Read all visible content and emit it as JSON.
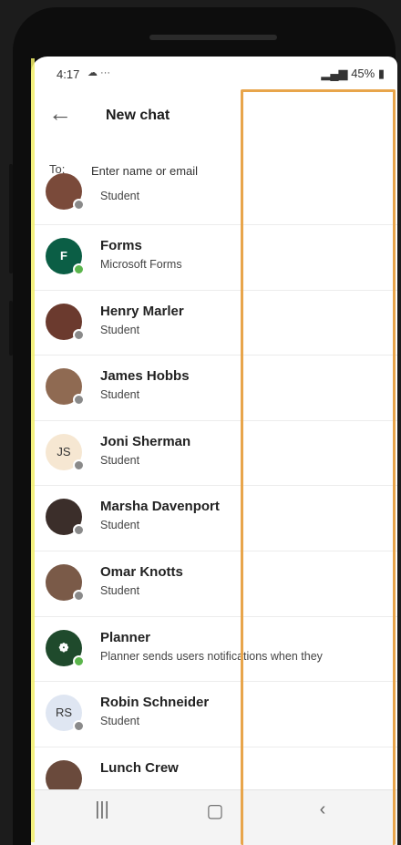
{
  "status_bar": {
    "time": "4:17",
    "icons_left": "☁ ···",
    "battery": "45%"
  },
  "header": {
    "back_icon": "arrow-left-icon",
    "title": "New chat"
  },
  "to_field": {
    "label": "To:",
    "placeholder": "Enter name or email"
  },
  "contacts": [
    {
      "name": "",
      "subtitle": "Student",
      "initials": "",
      "avatar_color": "#7a4a3a",
      "presence": "away"
    },
    {
      "name": "Forms",
      "subtitle": "Microsoft Forms",
      "initials": "F",
      "avatar_color": "#0b5e45",
      "presence": "available"
    },
    {
      "name": "Henry Marler",
      "subtitle": "Student",
      "initials": "",
      "avatar_color": "#6b3a2e",
      "presence": "away"
    },
    {
      "name": "James Hobbs",
      "subtitle": "Student",
      "initials": "",
      "avatar_color": "#8f6a52",
      "presence": "away"
    },
    {
      "name": "Joni Sherman",
      "subtitle": "Student",
      "initials": "JS",
      "avatar_color": "#f6e7d2",
      "presence": "away"
    },
    {
      "name": "Marsha Davenport",
      "subtitle": "Student",
      "initials": "",
      "avatar_color": "#3b2e2a",
      "presence": "away"
    },
    {
      "name": "Omar Knotts",
      "subtitle": "Student",
      "initials": "",
      "avatar_color": "#7a5a48",
      "presence": "away"
    },
    {
      "name": "Planner",
      "subtitle": "Planner sends users notifications when they",
      "initials": "❁",
      "avatar_color": "#1f4a2c",
      "presence": "available"
    },
    {
      "name": "Robin Schneider",
      "subtitle": "Student",
      "initials": "RS",
      "avatar_color": "#dfe6f2",
      "presence": "away"
    },
    {
      "name": "Lunch Crew",
      "subtitle": "",
      "initials": "",
      "avatar_color": "#6a4a3c",
      "presence": "none"
    }
  ],
  "nav_bar": {
    "recents": "|||",
    "home": "▢",
    "back": "‹"
  },
  "colors": {
    "highlight_border": "#e8a54b",
    "left_marker": "#f2ee6a",
    "presence_available": "#5bb54c",
    "presence_away": "#8a8a8a"
  }
}
